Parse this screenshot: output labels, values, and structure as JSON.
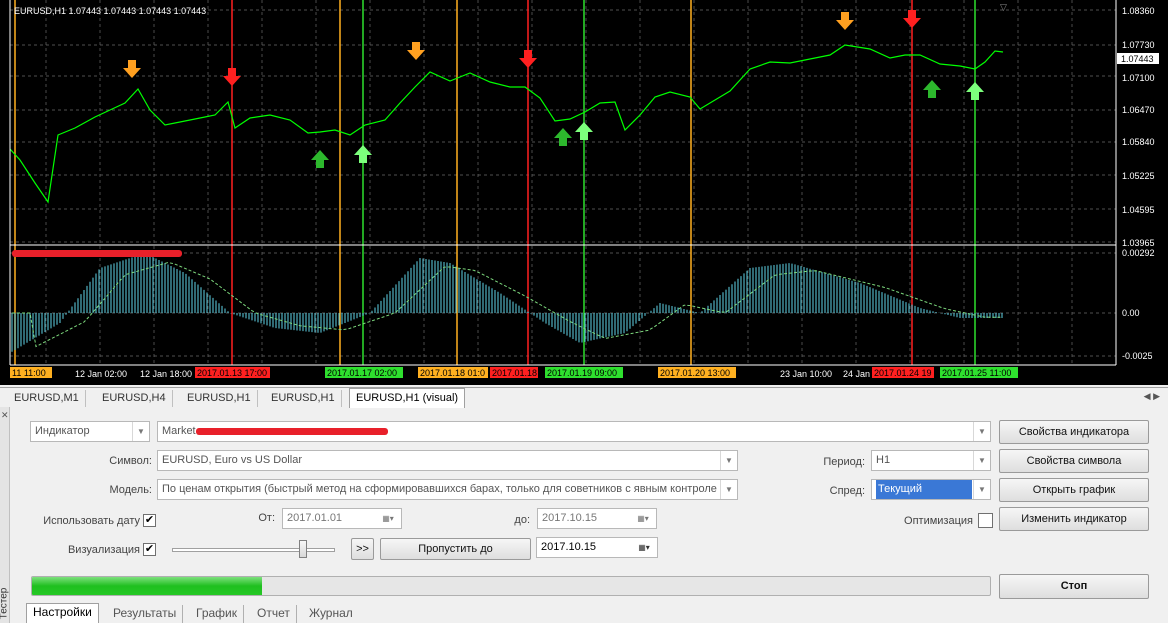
{
  "chart": {
    "symbol_header": "EURUSD,H1  1.07443 1.07443 1.07443 1.07443",
    "current_price": "1.07443",
    "price_ticks": [
      "1.08360",
      "1.07730",
      "1.07100",
      "1.06470",
      "1.05840",
      "1.05225",
      "1.04595",
      "1.03965"
    ],
    "indicator_ticks": [
      "0.00292",
      "0.00",
      "-0.0025"
    ],
    "time_ticks": [
      "12 Jan 02:00",
      "12 Jan 18:00",
      "23 Jan 10:00",
      "24 Jan"
    ],
    "signal_labels": [
      "11 11:00",
      "2017.01.13 17:00",
      "2017.01.17 02:00",
      "2017.01.18 01:0",
      "2017.01.18",
      "2017.01.19 09:00",
      "2017.01.20 13:00",
      "2017.01.24 19",
      "2017.01.25 11:00"
    ],
    "colors": {
      "price_line": "#00ff00",
      "histogram": "#5fd5e8",
      "signal_line": "#7cd77c",
      "buy_arrow": "#2db82d",
      "buy_arrow_light": "#7cff7c",
      "sell_arrow": "#ff2020",
      "top_arrow": "#ffa020",
      "vline_orange": "#ffb020",
      "vline_red": "#ff2020",
      "vline_green": "#2ee02e"
    }
  },
  "chart_tabs": [
    "EURUSD,M1",
    "EURUSD,H4",
    "EURUSD,H1",
    "EURUSD,H1",
    "EURUSD,H1 (visual)"
  ],
  "tester": {
    "side_label": "Тестер",
    "type_select": "Индикатор",
    "expert_select": "Market",
    "symbol_label": "Символ:",
    "symbol_value": "EURUSD, Euro vs US Dollar",
    "model_label": "Модель:",
    "model_value": "По ценам открытия (быстрый метод на сформировавшихся барах, только для советников с явным контроле",
    "use_date_label": "Использовать дату",
    "use_date_checked": true,
    "from_label": "От:",
    "from_value": "2017.01.01",
    "to_label": "до:",
    "to_value": "2017.10.15",
    "visualization_label": "Визуализация",
    "visualization_checked": true,
    "skip_button_fast": ">>",
    "skip_to_label": "Пропустить до",
    "skip_to_value": "2017.10.15",
    "period_label": "Период:",
    "period_value": "H1",
    "spread_label": "Спред:",
    "spread_value": "Текущий",
    "optimization_label": "Оптимизация",
    "optimization_checked": false,
    "btn_indicator_props": "Свойства индикатора",
    "btn_symbol_props": "Свойства символа",
    "btn_open_chart": "Открыть график",
    "btn_modify_indicator": "Изменить индикатор",
    "btn_stop": "Стоп",
    "progress": 0.24
  },
  "bottom_tabs": [
    "Настройки",
    "Результаты",
    "График",
    "Отчет",
    "Журнал"
  ]
}
